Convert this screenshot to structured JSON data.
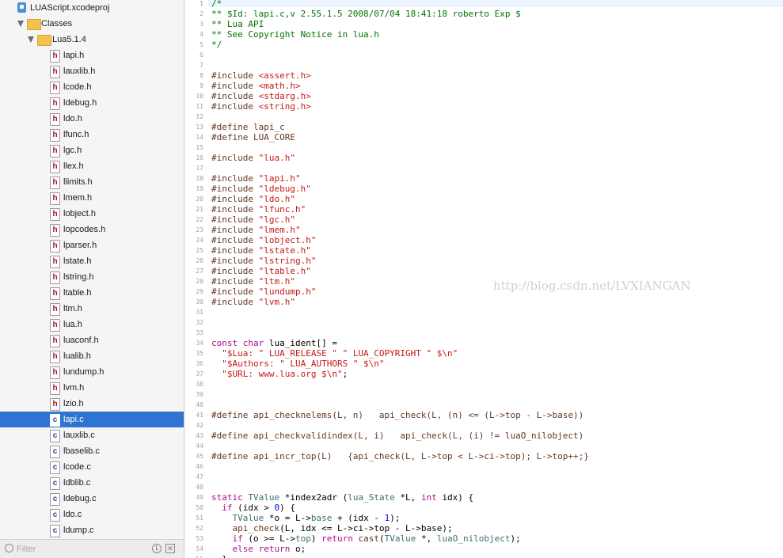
{
  "navigator": {
    "project": "LUAScript.xcodeproj",
    "group": "Classes",
    "subgroup": "Lua5.1.4",
    "files": [
      {
        "name": "lapi.h",
        "type": "h"
      },
      {
        "name": "lauxlib.h",
        "type": "h"
      },
      {
        "name": "lcode.h",
        "type": "h"
      },
      {
        "name": "ldebug.h",
        "type": "h"
      },
      {
        "name": "ldo.h",
        "type": "h"
      },
      {
        "name": "lfunc.h",
        "type": "h"
      },
      {
        "name": "lgc.h",
        "type": "h"
      },
      {
        "name": "llex.h",
        "type": "h"
      },
      {
        "name": "llimits.h",
        "type": "h"
      },
      {
        "name": "lmem.h",
        "type": "h"
      },
      {
        "name": "lobject.h",
        "type": "h"
      },
      {
        "name": "lopcodes.h",
        "type": "h"
      },
      {
        "name": "lparser.h",
        "type": "h"
      },
      {
        "name": "lstate.h",
        "type": "h"
      },
      {
        "name": "lstring.h",
        "type": "h"
      },
      {
        "name": "ltable.h",
        "type": "h"
      },
      {
        "name": "ltm.h",
        "type": "h"
      },
      {
        "name": "lua.h",
        "type": "h"
      },
      {
        "name": "luaconf.h",
        "type": "h"
      },
      {
        "name": "lualib.h",
        "type": "h"
      },
      {
        "name": "lundump.h",
        "type": "h"
      },
      {
        "name": "lvm.h",
        "type": "h"
      },
      {
        "name": "lzio.h",
        "type": "h"
      },
      {
        "name": "lapi.c",
        "type": "c",
        "selected": true
      },
      {
        "name": "lauxlib.c",
        "type": "c"
      },
      {
        "name": "lbaselib.c",
        "type": "c"
      },
      {
        "name": "lcode.c",
        "type": "c"
      },
      {
        "name": "ldblib.c",
        "type": "c"
      },
      {
        "name": "ldebug.c",
        "type": "c"
      },
      {
        "name": "ldo.c",
        "type": "c"
      },
      {
        "name": "ldump.c",
        "type": "c"
      }
    ],
    "filter_placeholder": "Filter",
    "icons": {
      "project": "xcodeproj-icon",
      "folder": "folder-icon",
      "header": "header-file-icon",
      "source": "c-file-icon",
      "filter": "filter-icon",
      "recent": "clock-icon",
      "scm": "scm-filter-icon"
    },
    "colors": {
      "selection": "#2f74d3",
      "header_letter": "#a5142b",
      "source_letter": "#354a8a"
    }
  },
  "editor": {
    "watermark": "http://blog.csdn.net/LVXIANGAN",
    "lines": [
      {
        "n": "1",
        "s": [
          [
            "cm",
            "/*"
          ]
        ]
      },
      {
        "n": "2",
        "s": [
          [
            "cm",
            "** $Id: lapi.c,v 2.55.1.5 2008/07/04 18:41:18 roberto Exp $"
          ]
        ]
      },
      {
        "n": "3",
        "s": [
          [
            "cm",
            "** Lua API"
          ]
        ]
      },
      {
        "n": "4",
        "s": [
          [
            "cm",
            "** See Copyright Notice in lua.h"
          ]
        ]
      },
      {
        "n": "5",
        "s": [
          [
            "cm",
            "*/"
          ]
        ]
      },
      {
        "n": "6",
        "s": []
      },
      {
        "n": "7",
        "s": []
      },
      {
        "n": "8",
        "s": [
          [
            "pp",
            "#include "
          ],
          [
            "st",
            "<assert.h>"
          ]
        ]
      },
      {
        "n": "9",
        "s": [
          [
            "pp",
            "#include "
          ],
          [
            "st",
            "<math.h>"
          ]
        ]
      },
      {
        "n": "10",
        "s": [
          [
            "pp",
            "#include "
          ],
          [
            "st",
            "<stdarg.h>"
          ]
        ]
      },
      {
        "n": "11",
        "s": [
          [
            "pp",
            "#include "
          ],
          [
            "st",
            "<string.h>"
          ]
        ]
      },
      {
        "n": "12",
        "s": []
      },
      {
        "n": "13",
        "s": [
          [
            "pp",
            "#define lapi_c"
          ]
        ]
      },
      {
        "n": "14",
        "s": [
          [
            "pp",
            "#define LUA_CORE"
          ]
        ]
      },
      {
        "n": "15",
        "s": []
      },
      {
        "n": "16",
        "s": [
          [
            "pp",
            "#include "
          ],
          [
            "st",
            "\"lua.h\""
          ]
        ]
      },
      {
        "n": "17",
        "s": []
      },
      {
        "n": "18",
        "s": [
          [
            "pp",
            "#include "
          ],
          [
            "st",
            "\"lapi.h\""
          ]
        ]
      },
      {
        "n": "19",
        "s": [
          [
            "pp",
            "#include "
          ],
          [
            "st",
            "\"ldebug.h\""
          ]
        ]
      },
      {
        "n": "20",
        "s": [
          [
            "pp",
            "#include "
          ],
          [
            "st",
            "\"ldo.h\""
          ]
        ]
      },
      {
        "n": "21",
        "s": [
          [
            "pp",
            "#include "
          ],
          [
            "st",
            "\"lfunc.h\""
          ]
        ]
      },
      {
        "n": "22",
        "s": [
          [
            "pp",
            "#include "
          ],
          [
            "st",
            "\"lgc.h\""
          ]
        ]
      },
      {
        "n": "23",
        "s": [
          [
            "pp",
            "#include "
          ],
          [
            "st",
            "\"lmem.h\""
          ]
        ]
      },
      {
        "n": "24",
        "s": [
          [
            "pp",
            "#include "
          ],
          [
            "st",
            "\"lobject.h\""
          ]
        ]
      },
      {
        "n": "25",
        "s": [
          [
            "pp",
            "#include "
          ],
          [
            "st",
            "\"lstate.h\""
          ]
        ]
      },
      {
        "n": "26",
        "s": [
          [
            "pp",
            "#include "
          ],
          [
            "st",
            "\"lstring.h\""
          ]
        ]
      },
      {
        "n": "27",
        "s": [
          [
            "pp",
            "#include "
          ],
          [
            "st",
            "\"ltable.h\""
          ]
        ]
      },
      {
        "n": "28",
        "s": [
          [
            "pp",
            "#include "
          ],
          [
            "st",
            "\"ltm.h\""
          ]
        ]
      },
      {
        "n": "29",
        "s": [
          [
            "pp",
            "#include "
          ],
          [
            "st",
            "\"lundump.h\""
          ]
        ]
      },
      {
        "n": "30",
        "s": [
          [
            "pp",
            "#include "
          ],
          [
            "st",
            "\"lvm.h\""
          ]
        ]
      },
      {
        "n": "31",
        "s": []
      },
      {
        "n": "32",
        "s": []
      },
      {
        "n": "33",
        "s": []
      },
      {
        "n": "34",
        "s": [
          [
            "kw",
            "const char "
          ],
          [
            "pl",
            "lua_ident[] ="
          ]
        ]
      },
      {
        "n": "35",
        "s": [
          [
            "pl",
            "  "
          ],
          [
            "st",
            "\"$Lua: \" LUA_RELEASE \" \" LUA_COPYRIGHT \" $\\n\""
          ]
        ]
      },
      {
        "n": "36",
        "s": [
          [
            "pl",
            "  "
          ],
          [
            "st",
            "\"$Authors: \" LUA_AUTHORS \" $\\n\""
          ]
        ]
      },
      {
        "n": "37",
        "s": [
          [
            "pl",
            "  "
          ],
          [
            "st",
            "\"$URL: www.lua.org $\\n\""
          ],
          [
            "pl",
            ";"
          ]
        ]
      },
      {
        "n": "38",
        "s": []
      },
      {
        "n": "39",
        "s": []
      },
      {
        "n": "40",
        "s": []
      },
      {
        "n": "41",
        "s": [
          [
            "pp",
            "#define api_checknelems(L, n)   api_check(L, (n) <= (L->top - L->base))"
          ]
        ]
      },
      {
        "n": "42",
        "s": []
      },
      {
        "n": "43",
        "s": [
          [
            "pp",
            "#define api_checkvalidindex(L, i)   api_check(L, (i) != luaO_nilobject)"
          ]
        ]
      },
      {
        "n": "44",
        "s": []
      },
      {
        "n": "45",
        "s": [
          [
            "pp",
            "#define api_incr_top(L)   {api_check(L, L->top < L->ci->top); L->top++;}"
          ]
        ]
      },
      {
        "n": "46",
        "s": []
      },
      {
        "n": "47",
        "s": []
      },
      {
        "n": "48",
        "s": []
      },
      {
        "n": "49",
        "s": [
          [
            "kw",
            "static "
          ],
          [
            "ty",
            "TValue "
          ],
          [
            "pl",
            "*index2adr ("
          ],
          [
            "ty",
            "lua_State "
          ],
          [
            "pl",
            "*L, "
          ],
          [
            "kw",
            "int "
          ],
          [
            "pl",
            "idx) {"
          ]
        ]
      },
      {
        "n": "50",
        "s": [
          [
            "pl",
            "  "
          ],
          [
            "kw",
            "if "
          ],
          [
            "pl",
            "(idx > "
          ],
          [
            "nm",
            "0"
          ],
          [
            "pl",
            ") {"
          ]
        ]
      },
      {
        "n": "51",
        "s": [
          [
            "pl",
            "    "
          ],
          [
            "ty",
            "TValue "
          ],
          [
            "pl",
            "*o = L->"
          ],
          [
            "ty",
            "base"
          ],
          [
            "pl",
            " + (idx - "
          ],
          [
            "nm",
            "1"
          ],
          [
            "pl",
            ");"
          ]
        ]
      },
      {
        "n": "52",
        "s": [
          [
            "pl",
            "    "
          ],
          [
            "pp",
            "api_check"
          ],
          [
            "pl",
            "(L, idx <= L->ci->top - L->base);"
          ]
        ]
      },
      {
        "n": "53",
        "s": [
          [
            "pl",
            "    "
          ],
          [
            "kw",
            "if "
          ],
          [
            "pl",
            "(o >= L->"
          ],
          [
            "ty",
            "top"
          ],
          [
            "pl",
            ") "
          ],
          [
            "kw",
            "return "
          ],
          [
            "pp",
            "cast"
          ],
          [
            "pl",
            "("
          ],
          [
            "ty",
            "TValue "
          ],
          [
            "pl",
            "*, "
          ],
          [
            "ty",
            "luaO_nilobject"
          ],
          [
            "pl",
            ");"
          ]
        ]
      },
      {
        "n": "54",
        "s": [
          [
            "pl",
            "    "
          ],
          [
            "kw",
            "else return "
          ],
          [
            "pl",
            "o;"
          ]
        ]
      },
      {
        "n": "55",
        "s": [
          [
            "pl",
            "  }"
          ]
        ]
      }
    ],
    "colors": {
      "comment": "#007400",
      "preprocessor": "#643820",
      "string": "#c41a16",
      "keyword": "#aa0d91",
      "number": "#1c00cf",
      "type": "#3f6e74"
    }
  }
}
